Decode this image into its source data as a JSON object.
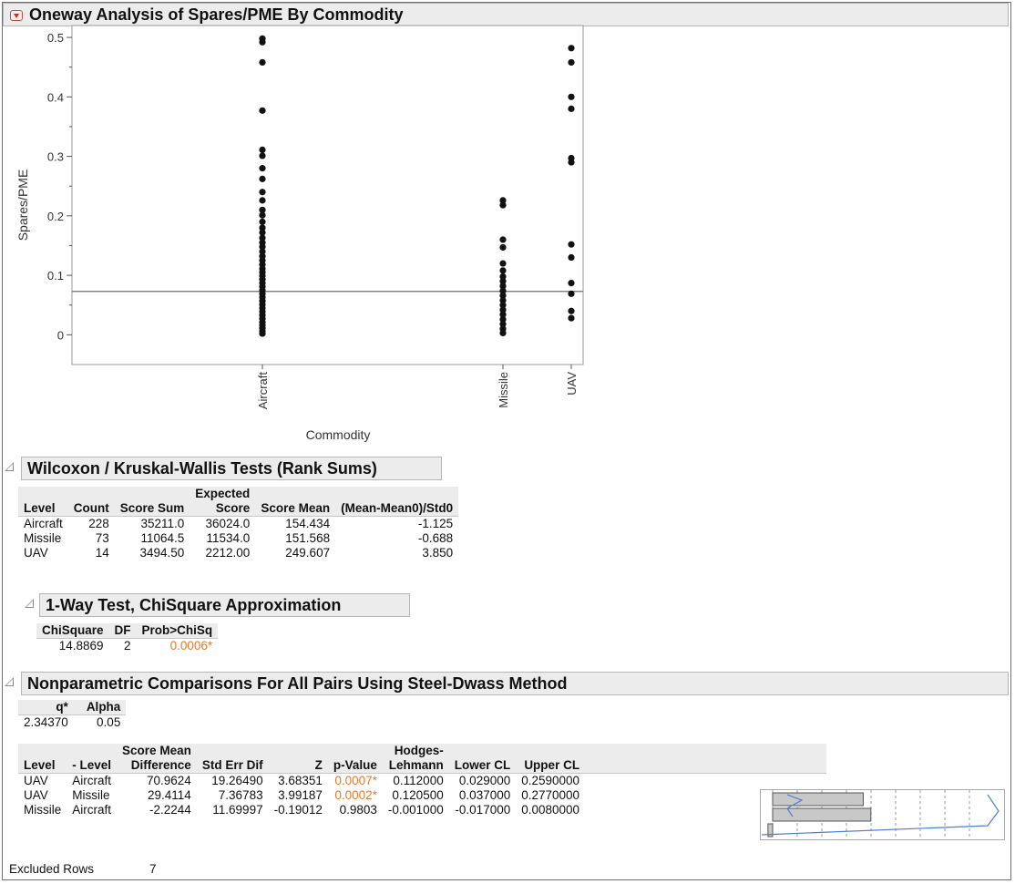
{
  "main": {
    "title": "Oneway Analysis of Spares/PME By Commodity"
  },
  "chart_data": {
    "type": "scatter",
    "xlabel": "Commodity",
    "ylabel": "Spares/PME",
    "categories": [
      "Aircraft",
      "Missile",
      "UAV"
    ],
    "ylim": [
      -0.05,
      0.52
    ],
    "yticks": [
      "0",
      "0.1",
      "0.2",
      "0.3",
      "0.4",
      "0.5"
    ],
    "mean_line": 0.073,
    "series": [
      {
        "category": "Aircraft",
        "values": [
          0.498,
          0.492,
          0.458,
          0.377,
          0.311,
          0.301,
          0.28,
          0.262,
          0.24,
          0.226,
          0.21,
          0.201,
          0.19,
          0.18,
          0.172,
          0.163,
          0.155,
          0.148,
          0.14,
          0.132,
          0.125,
          0.118,
          0.111,
          0.105,
          0.099,
          0.093,
          0.087,
          0.081,
          0.075,
          0.069,
          0.063,
          0.057,
          0.051,
          0.045,
          0.039,
          0.033,
          0.027,
          0.021,
          0.016,
          0.011,
          0.006,
          0.002
        ]
      },
      {
        "category": "Missile",
        "values": [
          0.226,
          0.218,
          0.16,
          0.147,
          0.12,
          0.108,
          0.098,
          0.09,
          0.082,
          0.074,
          0.066,
          0.058,
          0.05,
          0.042,
          0.034,
          0.026,
          0.018,
          0.01,
          0.003
        ]
      },
      {
        "category": "UAV",
        "values": [
          0.482,
          0.458,
          0.4,
          0.38,
          0.297,
          0.29,
          0.152,
          0.13,
          0.087,
          0.069,
          0.04,
          0.028
        ]
      }
    ]
  },
  "wilcoxon": {
    "title": "Wilcoxon / Kruskal-Wallis Tests (Rank Sums)",
    "headers": [
      "Level",
      "Count",
      "Score Sum",
      "Expected",
      "Score",
      "Score Mean",
      "(Mean-Mean0)/Std0"
    ],
    "rows": [
      [
        "Aircraft",
        "228",
        "35211.0",
        "36024.0",
        "154.434",
        "-1.125"
      ],
      [
        "Missile",
        "73",
        "11064.5",
        "11534.0",
        "151.568",
        "-0.688"
      ],
      [
        "UAV",
        "14",
        "3494.50",
        "2212.00",
        "249.607",
        "3.850"
      ]
    ]
  },
  "oneway": {
    "title": "1-Way Test, ChiSquare Approximation",
    "headers": [
      "ChiSquare",
      "DF",
      "Prob>ChiSq"
    ],
    "row": [
      "14.8869",
      "2",
      "0.0006*"
    ]
  },
  "nonpar": {
    "title": "Nonparametric Comparisons For All Pairs Using Steel-Dwass  Method",
    "q_headers": [
      "q*",
      "Alpha"
    ],
    "q_row": [
      "2.34370",
      "0.05"
    ],
    "headers": [
      "Level",
      "- Level",
      "Score Mean",
      "Difference",
      "Std Err Dif",
      "Z",
      "p-Value",
      "Hodges-",
      "Lehmann",
      "Lower CL",
      "Upper CL"
    ],
    "rows": [
      [
        "UAV",
        "Aircraft",
        "70.9624",
        "19.26490",
        "3.68351",
        "0.0007*",
        "0.112000",
        "0.029000",
        "0.2590000"
      ],
      [
        "UAV",
        "Missile",
        "29.4114",
        "7.36783",
        "3.99187",
        "0.0002*",
        "0.120500",
        "0.037000",
        "0.2770000"
      ],
      [
        "Missile",
        "Aircraft",
        "-2.2244",
        "11.69997",
        "-0.19012",
        "0.9803",
        "-0.001000",
        "-0.017000",
        "0.0080000"
      ]
    ],
    "bars": [
      3.68351,
      3.99187,
      -0.19012
    ]
  },
  "footer": {
    "label": "Excluded Rows",
    "value": "7"
  }
}
